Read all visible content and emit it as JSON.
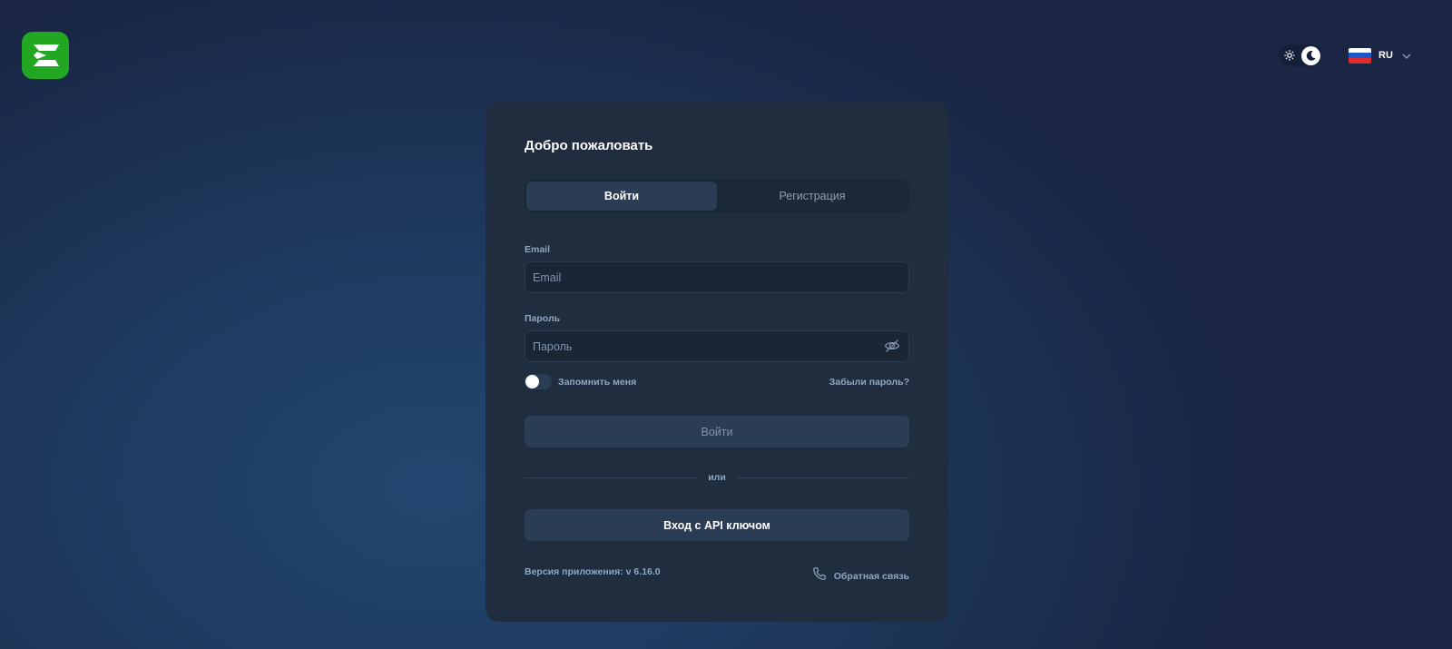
{
  "brand": {
    "logo_icon": "brand-logo-icon",
    "color": "#22a722"
  },
  "header": {
    "theme_toggle": {
      "light_icon": "sun-icon",
      "dark_icon": "moon-icon",
      "active": "dark"
    },
    "language": {
      "code": "RU",
      "flag_icon": "russia-flag-icon",
      "dropdown_icon": "chevron-down-icon"
    }
  },
  "card": {
    "title": "Добро пожаловать",
    "tabs": [
      {
        "label": "Войти",
        "active": true
      },
      {
        "label": "Регистрация",
        "active": false
      }
    ],
    "email": {
      "label": "Email",
      "placeholder": "Email",
      "value": ""
    },
    "password": {
      "label": "Пароль",
      "placeholder": "Пароль",
      "value": "",
      "toggle_icon": "eye-off-icon"
    },
    "remember_me": {
      "label": "Запомнить меня",
      "checked": false
    },
    "forgot_password": "Забыли пароль?",
    "login_button": "Войти",
    "divider_text": "или",
    "api_key_button": "Вход с API ключом",
    "version": "Версия приложения: v 6.16.0",
    "feedback": {
      "label": "Обратная связь",
      "icon": "phone-icon"
    }
  },
  "colors": {
    "card_bg": "#1f2d3f",
    "accent": "#2b3d54",
    "muted_text": "#8fa6c2"
  }
}
